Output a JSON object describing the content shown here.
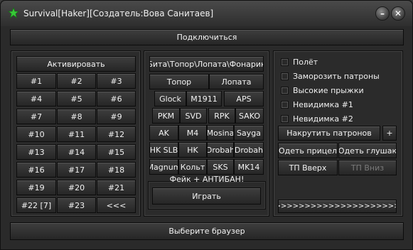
{
  "window": {
    "title": "Survival[Haker][Создатель:Вова Санитаев]",
    "minimize_glyph": "–",
    "close_glyph": "✕",
    "icon": "green-star-icon",
    "accent": "#37c837"
  },
  "connect_label": "Подключиться",
  "browser_label": "Выберите браузер",
  "left_panel": {
    "activate_label": "Активировать",
    "slots": [
      "#1",
      "#2",
      "#3",
      "#4",
      "#5",
      "#6",
      "#7",
      "#8",
      "#9",
      "#10",
      "#11",
      "#12",
      "#13",
      "#14",
      "#15",
      "#16",
      "#17",
      "#18",
      "#19",
      "#20",
      "#21",
      "#22 [7]",
      "#23",
      "<<<"
    ]
  },
  "middle_panel": {
    "melee_all": "Бита\\Топор\\Лопата\\Фонарик",
    "axe": "Топор",
    "shovel": "Лопата",
    "weapons": [
      "Glock",
      "M1911",
      "APS",
      "PKM",
      "SVD",
      "RPK",
      "SAKO",
      "AK",
      "M4",
      "Mosina",
      "Sayga",
      "HK SLB",
      "HK",
      "Drobah",
      "Drobah",
      "Magnum",
      "Кольт",
      "SKS",
      "MK14"
    ],
    "fake_label": "Фейк + АНТИБАН!",
    "play_label": "Играть"
  },
  "right_panel": {
    "checks": [
      "Полёт",
      "Заморозить патроны",
      "Высокие прыжки",
      "Невидимка #1",
      "Невидимка #2"
    ],
    "ammo_label": "Накрутить патронов",
    "ammo_plus": "+",
    "scope_label": "Одеть прицел",
    "silencer_label": "Одеть глушак",
    "tp_up": "ТП Вверх",
    "tp_down": "ТП Вниз",
    "progress_label": ">>>>>>>>>>>>>>>>>>>>>>>"
  }
}
